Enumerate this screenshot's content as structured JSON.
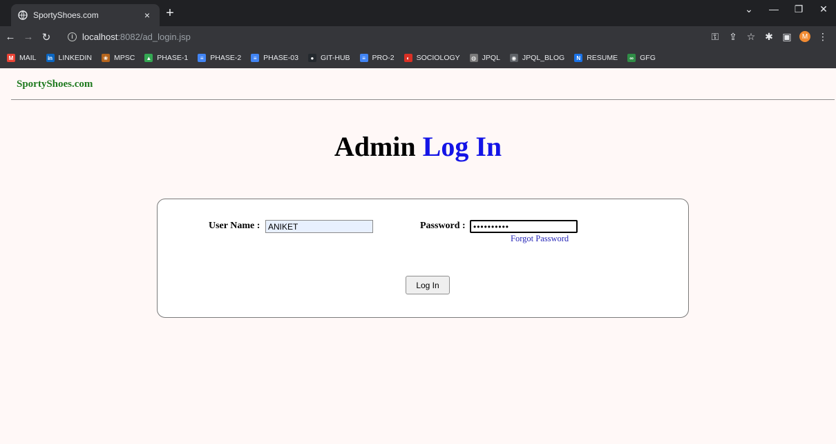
{
  "browser": {
    "tab_title": "SportyShoes.com",
    "tab_close": "×",
    "new_tab": "+",
    "url_host": "localhost",
    "url_rest": ":8082/ad_login.jsp",
    "avatar_letter": "M"
  },
  "bookmarks": [
    {
      "label": "MAIL",
      "icon": "gmail-icon",
      "color": "#ea4335",
      "glyph": "M"
    },
    {
      "label": "LINKEDIN",
      "icon": "linkedin-icon",
      "color": "#0a66c2",
      "glyph": "in"
    },
    {
      "label": "MPSC",
      "icon": "mpsc-emblem-icon",
      "color": "#b5651d",
      "glyph": "❀"
    },
    {
      "label": "PHASE-1",
      "icon": "drive-icon",
      "color": "#34a853",
      "glyph": "▲"
    },
    {
      "label": "PHASE-2",
      "icon": "docs-icon",
      "color": "#4285f4",
      "glyph": "≡"
    },
    {
      "label": "PHASE-03",
      "icon": "docs-icon",
      "color": "#4285f4",
      "glyph": "≡"
    },
    {
      "label": "GIT-HUB",
      "icon": "github-icon",
      "color": "#24292e",
      "glyph": "●"
    },
    {
      "label": "PRO-2",
      "icon": "docs-icon",
      "color": "#4285f4",
      "glyph": "≡"
    },
    {
      "label": "SOCIOLOGY",
      "icon": "sociology-icon",
      "color": "#d93025",
      "glyph": "◐"
    },
    {
      "label": "JPQL",
      "icon": "jpql-icon",
      "color": "#7a7a7a",
      "glyph": "◍"
    },
    {
      "label": "JPQL_BLOG",
      "icon": "globe-icon",
      "color": "#5f6368",
      "glyph": "◉"
    },
    {
      "label": "RESUME",
      "icon": "resume-icon",
      "color": "#1a73e8",
      "glyph": "N"
    },
    {
      "label": "GFG",
      "icon": "gfg-icon",
      "color": "#2f8d46",
      "glyph": "∞"
    }
  ],
  "page": {
    "brand": "SportyShoes.com",
    "heading_part1": "Admin",
    "heading_part2": "Log In",
    "username_label": "User Name :",
    "username_value": "ANIKET",
    "password_label": "Password :",
    "password_value": "••••••••••",
    "forgot_link": "Forgot Password",
    "login_button": "Log In"
  },
  "colors": {
    "brand": "#1f7a1f",
    "heading_accent": "#1414e6",
    "page_bg": "#fff8f7"
  }
}
